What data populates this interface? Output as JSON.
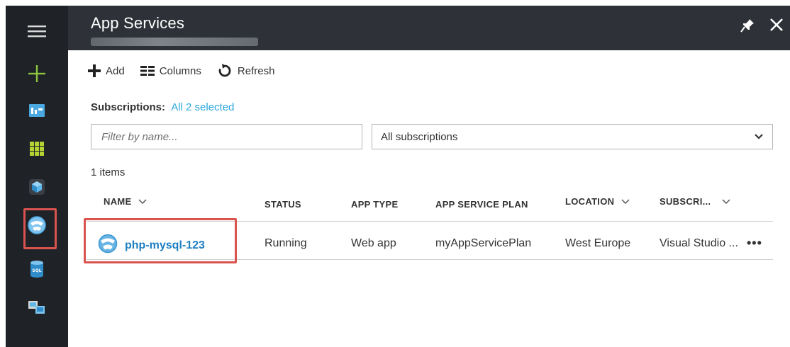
{
  "rail": {
    "items": [
      {
        "name": "hamburger-menu-icon"
      },
      {
        "name": "new-plus-icon"
      },
      {
        "name": "dashboard-icon"
      },
      {
        "name": "all-resources-icon"
      },
      {
        "name": "resource-groups-icon"
      },
      {
        "name": "app-services-icon"
      },
      {
        "name": "sql-databases-icon"
      },
      {
        "name": "virtual-machines-icon"
      }
    ],
    "highlight_color": "#d9534f"
  },
  "header": {
    "title": "App Services",
    "pin_icon": "pin-icon",
    "close_icon": "close-icon"
  },
  "toolbar": {
    "add_label": "Add",
    "columns_label": "Columns",
    "refresh_label": "Refresh"
  },
  "subscriptions": {
    "label": "Subscriptions:",
    "value": "All 2 selected",
    "link_color": "#2aa7dd"
  },
  "filter": {
    "placeholder": "Filter by name..."
  },
  "subscription_select": {
    "value": "All subscriptions"
  },
  "items_count": "1 items",
  "table": {
    "headers": {
      "name": "NAME",
      "status": "STATUS",
      "app_type": "APP TYPE",
      "plan": "APP SERVICE PLAN",
      "location": "LOCATION",
      "subscription": "SUBSCRI..."
    },
    "rows": [
      {
        "name": "php-mysql-123",
        "status": "Running",
        "app_type": "Web app",
        "plan": "myAppServicePlan",
        "location": "West Europe",
        "subscription": "Visual Studio ...",
        "more": "•••"
      }
    ],
    "name_color": "#1f7fc1"
  }
}
